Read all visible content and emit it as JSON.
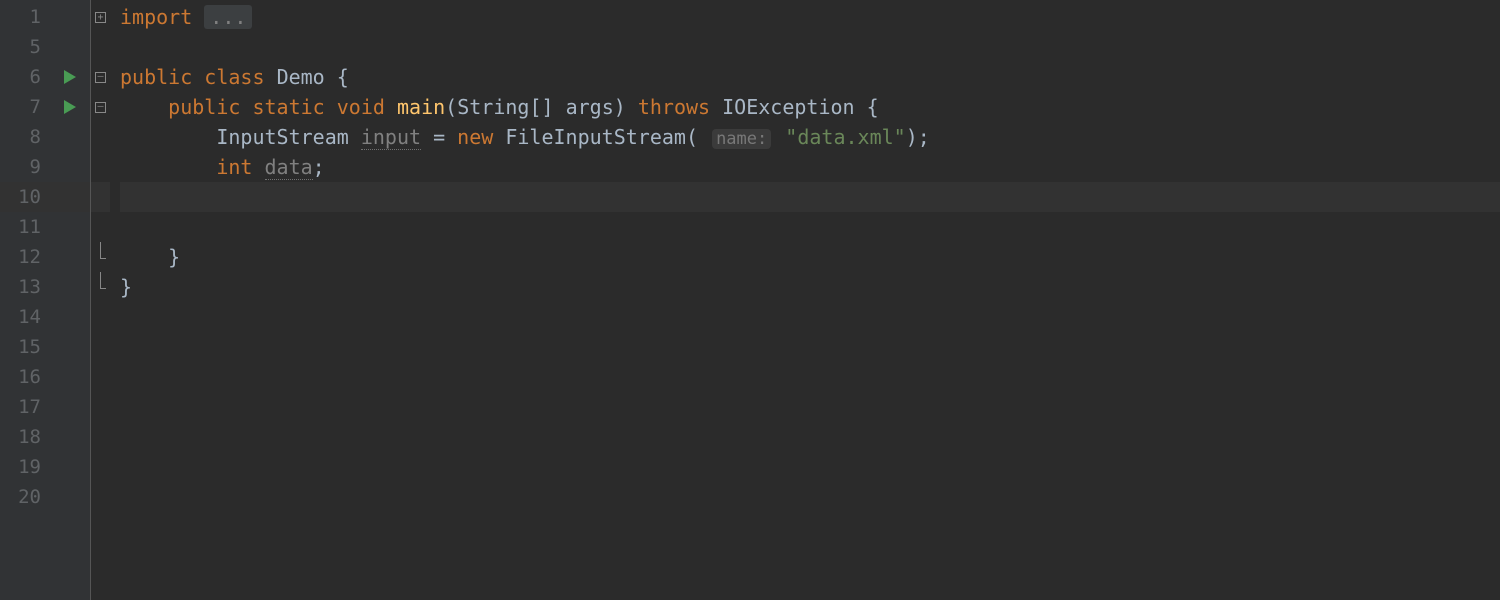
{
  "gutter": {
    "lines": [
      "1",
      "5",
      "6",
      "7",
      "8",
      "9",
      "10",
      "11",
      "12",
      "13",
      "14",
      "15",
      "16",
      "17",
      "18",
      "19",
      "20"
    ]
  },
  "run_markers": {
    "rows_with_marker": [
      2,
      3
    ]
  },
  "fold_markers": {
    "0": "plus",
    "2": "minus",
    "3": "minus",
    "8": "end",
    "9": "end"
  },
  "code": {
    "l0_import": "import",
    "l0_dots": "...",
    "l2_public": "public",
    "l2_class": "class",
    "l2_name": "Demo",
    "l2_brace": " {",
    "l3_public": "public",
    "l3_static": "static",
    "l3_void": "void",
    "l3_main": "main",
    "l3_params_open": "(",
    "l3_params_type": "String[] args",
    "l3_params_close": ")",
    "l3_throws": "throws",
    "l3_exception": "IOException",
    "l3_brace": " {",
    "l4_type": "InputStream",
    "l4_var": "input",
    "l4_eq": " = ",
    "l4_new": "new",
    "l4_ctor": "FileInputStream",
    "l4_open": "(",
    "l4_hint": "name:",
    "l4_string": "\"data.xml\"",
    "l4_close": ");",
    "l5_type": "int",
    "l5_var": "data",
    "l5_semi": ";",
    "l8_close": "}",
    "l9_close": "}"
  }
}
